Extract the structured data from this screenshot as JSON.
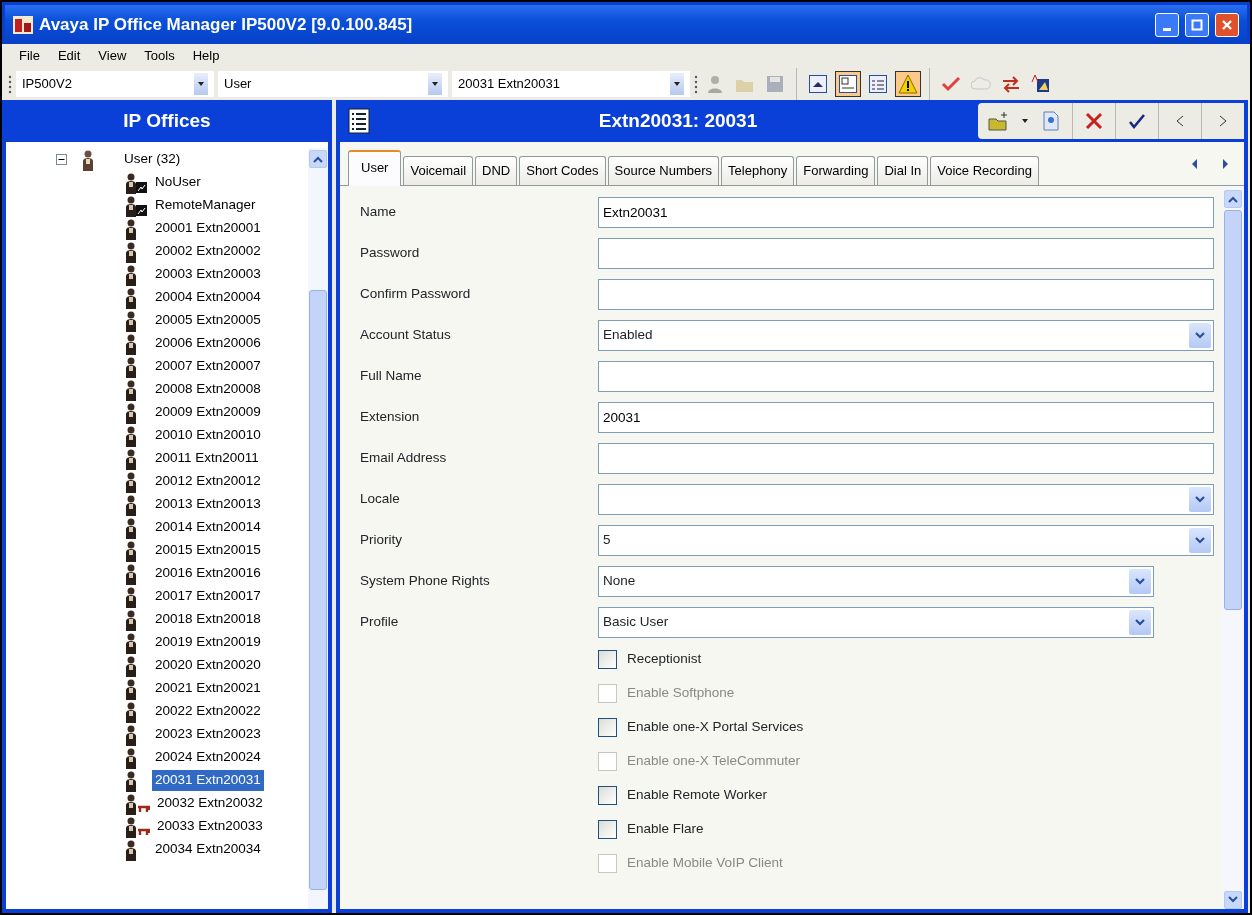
{
  "window": {
    "title": "Avaya IP Office Manager IP500V2 [9.0.100.845]"
  },
  "menu": [
    "File",
    "Edit",
    "View",
    "Tools",
    "Help"
  ],
  "selectors": [
    {
      "value": "IP500V2"
    },
    {
      "value": "User"
    },
    {
      "value": "20031 Extn20031"
    }
  ],
  "toolbar": [
    {
      "kind": "user",
      "disabled": true,
      "pressed": false
    },
    {
      "kind": "open",
      "disabled": true,
      "pressed": false
    },
    {
      "kind": "save",
      "disabled": true,
      "pressed": false
    },
    {
      "kind": "up",
      "disabled": false,
      "pressed": false
    },
    {
      "kind": "details",
      "disabled": false,
      "pressed": true
    },
    {
      "kind": "list",
      "disabled": false,
      "pressed": false
    },
    {
      "kind": "warning",
      "disabled": false,
      "pressed": true
    },
    {
      "kind": "check",
      "disabled": false,
      "pressed": false
    },
    {
      "kind": "cloud",
      "disabled": true,
      "pressed": false
    },
    {
      "kind": "swap",
      "disabled": false,
      "pressed": false
    },
    {
      "kind": "font",
      "disabled": false,
      "pressed": false
    }
  ],
  "sidebar": {
    "title": "IP Offices",
    "tree": [
      {
        "label": "User (32)",
        "expanded": true,
        "kind": "group",
        "selected": false,
        "children": [
          {
            "label": "NoUser",
            "kind": "special",
            "selected": false
          },
          {
            "label": "RemoteManager",
            "kind": "special",
            "selected": false
          },
          {
            "label": "20001 Extn20001",
            "kind": "user",
            "selected": false
          },
          {
            "label": "20002 Extn20002",
            "kind": "user",
            "selected": false
          },
          {
            "label": "20003 Extn20003",
            "kind": "user",
            "selected": false
          },
          {
            "label": "20004 Extn20004",
            "kind": "user",
            "selected": false
          },
          {
            "label": "20005 Extn20005",
            "kind": "user",
            "selected": false
          },
          {
            "label": "20006 Extn20006",
            "kind": "user",
            "selected": false
          },
          {
            "label": "20007 Extn20007",
            "kind": "user",
            "selected": false
          },
          {
            "label": "20008 Extn20008",
            "kind": "user",
            "selected": false
          },
          {
            "label": "20009 Extn20009",
            "kind": "user",
            "selected": false
          },
          {
            "label": "20010 Extn20010",
            "kind": "user",
            "selected": false
          },
          {
            "label": "20011 Extn20011",
            "kind": "user",
            "selected": false
          },
          {
            "label": "20012 Extn20012",
            "kind": "user",
            "selected": false
          },
          {
            "label": "20013 Extn20013",
            "kind": "user",
            "selected": false
          },
          {
            "label": "20014 Extn20014",
            "kind": "user",
            "selected": false
          },
          {
            "label": "20015 Extn20015",
            "kind": "user",
            "selected": false
          },
          {
            "label": "20016 Extn20016",
            "kind": "user",
            "selected": false
          },
          {
            "label": "20017 Extn20017",
            "kind": "user",
            "selected": false
          },
          {
            "label": "20018 Extn20018",
            "kind": "user",
            "selected": false
          },
          {
            "label": "20019 Extn20019",
            "kind": "user",
            "selected": false
          },
          {
            "label": "20020 Extn20020",
            "kind": "user",
            "selected": false
          },
          {
            "label": "20021 Extn20021",
            "kind": "user",
            "selected": false
          },
          {
            "label": "20022 Extn20022",
            "kind": "user",
            "selected": false
          },
          {
            "label": "20023 Extn20023",
            "kind": "user",
            "selected": false
          },
          {
            "label": "20024 Extn20024",
            "kind": "user",
            "selected": false
          },
          {
            "label": "20031 Extn20031",
            "kind": "user",
            "selected": true
          },
          {
            "label": "20032 Extn20032",
            "kind": "phone",
            "selected": false
          },
          {
            "label": "20033 Extn20033",
            "kind": "phone",
            "selected": false
          },
          {
            "label": "20034 Extn20034",
            "kind": "user",
            "selected": false
          }
        ]
      }
    ]
  },
  "editor": {
    "title": "Extn20031: 20031",
    "tabs": [
      {
        "label": "User",
        "selected": true
      },
      {
        "label": "Voicemail",
        "selected": false
      },
      {
        "label": "DND",
        "selected": false
      },
      {
        "label": "Short Codes",
        "selected": false
      },
      {
        "label": "Source Numbers",
        "selected": false
      },
      {
        "label": "Telephony",
        "selected": false
      },
      {
        "label": "Forwarding",
        "selected": false
      },
      {
        "label": "Dial In",
        "selected": false
      },
      {
        "label": "Voice Recording",
        "selected": false
      }
    ],
    "fields": [
      {
        "label": "Name",
        "kind": "text",
        "value": "Extn20031",
        "narrow": false
      },
      {
        "label": "Password",
        "kind": "text",
        "narrow": false
      },
      {
        "label": "Confirm Password",
        "kind": "text",
        "narrow": false
      },
      {
        "label": "Account Status",
        "kind": "select",
        "value": "Enabled",
        "narrow": false
      },
      {
        "label": "Full Name",
        "kind": "text",
        "narrow": false
      },
      {
        "label": "Extension",
        "kind": "text",
        "value": "20031",
        "narrow": false
      },
      {
        "label": "Email Address",
        "kind": "text",
        "narrow": false
      },
      {
        "label": "Locale",
        "kind": "select",
        "narrow": false
      },
      {
        "label": "Priority",
        "kind": "select",
        "value": "5",
        "narrow": false
      },
      {
        "label": "System Phone Rights",
        "kind": "select",
        "value": "None",
        "narrow": true
      },
      {
        "label": "Profile",
        "kind": "select",
        "value": "Basic User",
        "narrow": true
      }
    ],
    "checkboxes": [
      {
        "label": "Receptionist",
        "checked": false,
        "disabled": false
      },
      {
        "label": "Enable Softphone",
        "checked": false,
        "disabled": true
      },
      {
        "label": "Enable one-X Portal Services",
        "checked": false,
        "disabled": false
      },
      {
        "label": "Enable one-X TeleCommuter",
        "checked": false,
        "disabled": true
      },
      {
        "label": "Enable Remote Worker",
        "checked": false,
        "disabled": false
      },
      {
        "label": "Enable Flare",
        "checked": false,
        "disabled": false
      },
      {
        "label": "Enable Mobile VoIP Client",
        "checked": false,
        "disabled": true
      }
    ]
  }
}
